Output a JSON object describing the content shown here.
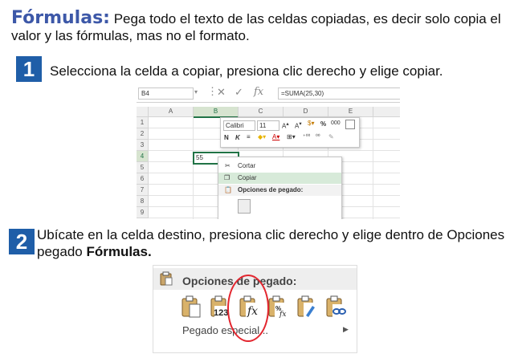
{
  "intro": {
    "word": "Fórmulas:",
    "text": " Pega todo el texto de las celdas copiadas, es decir solo copia el valor y las fórmulas, mas no el formato."
  },
  "step1": {
    "number": "1",
    "text": "Selecciona la celda a copiar, presiona clic derecho y elige copiar."
  },
  "step2": {
    "number": "2",
    "text_before": "Ubícate en la celda destino, presiona clic derecho y elige dentro de Opciones pegado ",
    "text_bold": "Fórmulas."
  },
  "excel": {
    "name_box": "B4",
    "formula": "=SUMA(25,30)",
    "columns": [
      "A",
      "B",
      "C",
      "D",
      "E"
    ],
    "rows": [
      "1",
      "2",
      "3",
      "4",
      "5",
      "6",
      "7",
      "8",
      "9"
    ],
    "cell_value": "55",
    "mini_toolbar": {
      "font": "Calibri",
      "size": "11",
      "percent": "%",
      "thousands": "000",
      "bold": "N",
      "italic": "K"
    },
    "context_menu": {
      "cut": "Cortar",
      "copy": "Copiar",
      "paste_options": "Opciones de pegado:"
    }
  },
  "paste_menu": {
    "title": "Opciones de pegado:",
    "icons": [
      "paste-icon",
      "paste-values-icon",
      "paste-formulas-icon",
      "paste-formulas-number-format-icon",
      "paste-formatting-icon",
      "paste-link-icon"
    ],
    "values_label": "123",
    "special": "Pegado especial...",
    "highlight_color": "#e3262f"
  },
  "colors": {
    "accent": "#3d58a8",
    "step_box": "#1f5ea8",
    "excel_green": "#217346"
  }
}
